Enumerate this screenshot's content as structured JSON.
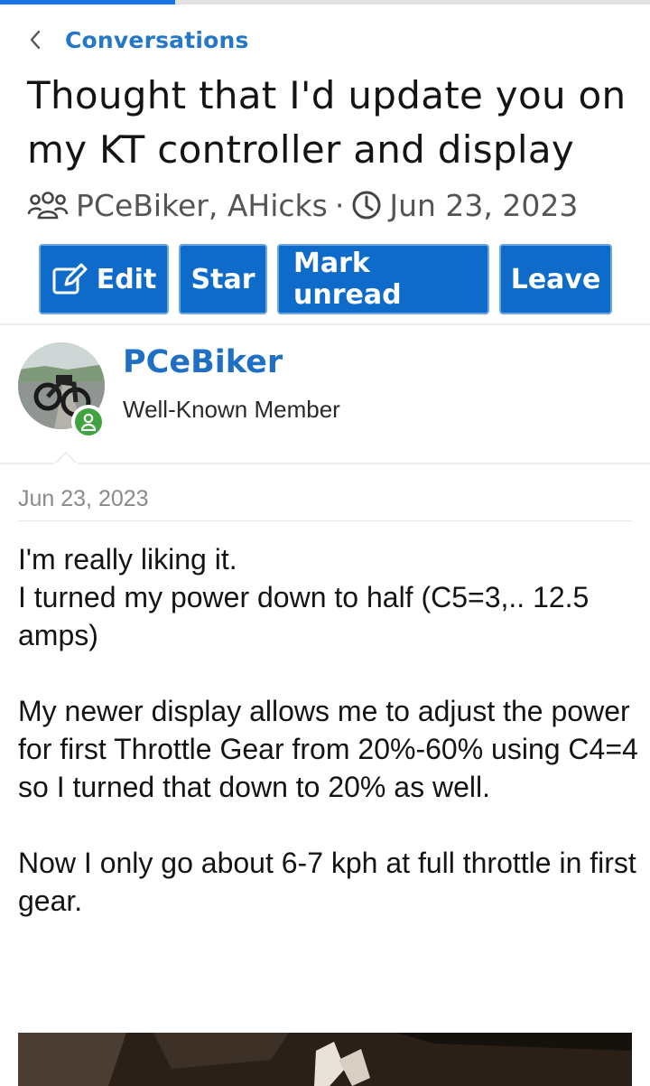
{
  "page_load_progress": 0.27,
  "breadcrumb": {
    "label": "Conversations",
    "icon": "chevron-left-icon"
  },
  "thread": {
    "title": "Thought that I'd update you on my KT controller and display",
    "participants": "PCeBiker, AHicks",
    "separator": "·",
    "date": "Jun 23, 2023",
    "participants_icon": "users-icon",
    "date_icon": "clock-icon"
  },
  "actions": {
    "edit": "Edit",
    "star": "Star",
    "mark_unread": "Mark unread",
    "leave": "Leave"
  },
  "post": {
    "author": {
      "name": "PCeBiker",
      "title": "Well-Known Member",
      "status": "online"
    },
    "date": "Jun 23, 2023",
    "paragraphs": [
      [
        "I'm really liking it.",
        "I turned my power down to half (C5=3,.. 12.5 amps)"
      ],
      [
        "My newer display allows me to adjust the power for first Throttle Gear from 20%-60% using C4=4 so I turned that down to 20% as well."
      ],
      [
        "Now I only go about 6-7 kph at full throttle in first gear."
      ]
    ]
  },
  "colors": {
    "accent": "#0e6bc9",
    "link": "#2577c8",
    "online": "#3fa33f",
    "progress": "#1a73e8"
  }
}
